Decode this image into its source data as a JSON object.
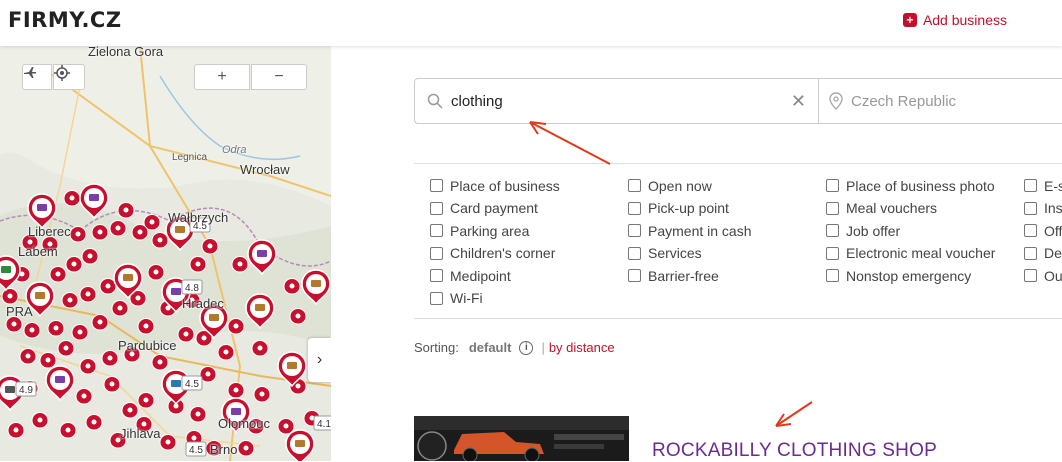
{
  "header": {
    "logo_text": "FIRMY.CZ",
    "add_business_label": "Add business",
    "accent_color": "#c4102a"
  },
  "map": {
    "cities": [
      "Zielona Gora",
      "Legnica",
      "Odra",
      "Wrocław",
      "Wałbrzych",
      "Liberec",
      "Labem",
      "PRA",
      "Pardubice",
      "Hradec",
      "Olomouc",
      "Jihlava",
      "Brno"
    ],
    "badges": [
      "4.5",
      "4.8",
      "4.9",
      "4.5",
      "4.5",
      "4.1"
    ],
    "zoom_in_label": "+",
    "zoom_out_label": "−",
    "expand_label": "›"
  },
  "search": {
    "what_value": "clothing",
    "where_placeholder": "Czech Republic",
    "clear_label": "✕"
  },
  "filters": [
    "Place of business",
    "Open now",
    "Place of business photo",
    "E-s",
    "Card payment",
    "Pick-up point",
    "Meal vouchers",
    "Ins",
    "Parking area",
    "Payment in cash",
    "Job offer",
    "Off",
    "Children's corner",
    "Services",
    "Electronic meal voucher",
    "De",
    "Medipoint",
    "Barrier-free",
    "Nonstop emergency",
    "Ou",
    "Wi-Fi"
  ],
  "sorting": {
    "label": "Sorting:",
    "default_label": "default",
    "info_label": "i",
    "separator": "|",
    "distance_label": "by distance"
  },
  "result": {
    "title": "ROCKABILLY CLOTHING SHOP",
    "title_color": "#6a2b8e"
  },
  "icons": [
    "search-icon",
    "location-pin-icon",
    "close-icon",
    "airplane-icon",
    "locate-icon",
    "info-icon",
    "chevron-right-icon",
    "map-pin-icon"
  ]
}
